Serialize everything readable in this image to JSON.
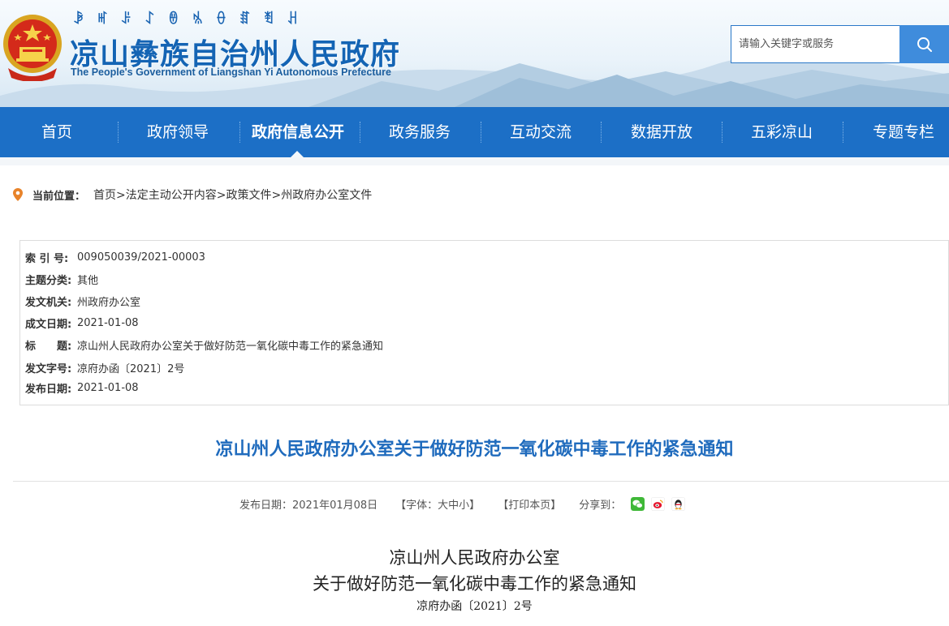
{
  "header": {
    "yi_script": "ꆃꎭꌠꋍꇩꁱꂷꏤꄮꃅ",
    "site_title": "凉山彝族自治州人民政府",
    "site_subtitle": "The People's Government of Liangshan Yi Autonomous Prefecture",
    "search_placeholder": "请输入关键字或服务"
  },
  "nav": {
    "items": [
      "首页",
      "政府领导",
      "政府信息公开",
      "政务服务",
      "互动交流",
      "数据开放",
      "五彩凉山",
      "专题专栏"
    ],
    "active": "政府信息公开"
  },
  "breadcrumb": {
    "label": "当前位置：",
    "path": "首页>法定主动公开内容>政策文件>州政府办公室文件"
  },
  "meta": {
    "index_label": "索 引 号:",
    "index_value": "009050039/2021-00003",
    "category_label": "主题分类:",
    "category_value": "其他",
    "issuer_label": "发文机关:",
    "issuer_value": "州政府办公室",
    "written_label": "成文日期:",
    "written_value": "2021-01-08",
    "title_label": "标　　题:",
    "title_value": "凉山州人民政府办公室关于做好防范一氧化碳中毒工作的紧急通知",
    "docno_label": "发文字号:",
    "docno_value": "凉府办函〔2021〕2号",
    "published_label": "发布日期:",
    "published_value": "2021-01-08"
  },
  "article": {
    "title": "凉山州人民政府办公室关于做好防范一氧化碳中毒工作的紧急通知",
    "publish_date": "发布日期：2021年01月08日",
    "font_size": "【字体：大中小】",
    "print": "【打印本页】",
    "share_label": "分享到：",
    "body_heading_1": "凉山州人民政府办公室",
    "body_heading_2": "关于做好防范一氧化碳中毒工作的紧急通知",
    "body_doc_number": "凉府办函〔2021〕2号"
  },
  "icons": {
    "emblem": "national-emblem-icon",
    "search": "search-icon",
    "location": "location-pin-icon",
    "share": [
      "wechat-icon",
      "weibo-icon",
      "qq-icon"
    ]
  },
  "colors": {
    "brand_blue": "#1c6fc6",
    "title_blue": "#1f6bbd",
    "search_button": "#3f8cdc",
    "location_icon": "#e8832a"
  }
}
